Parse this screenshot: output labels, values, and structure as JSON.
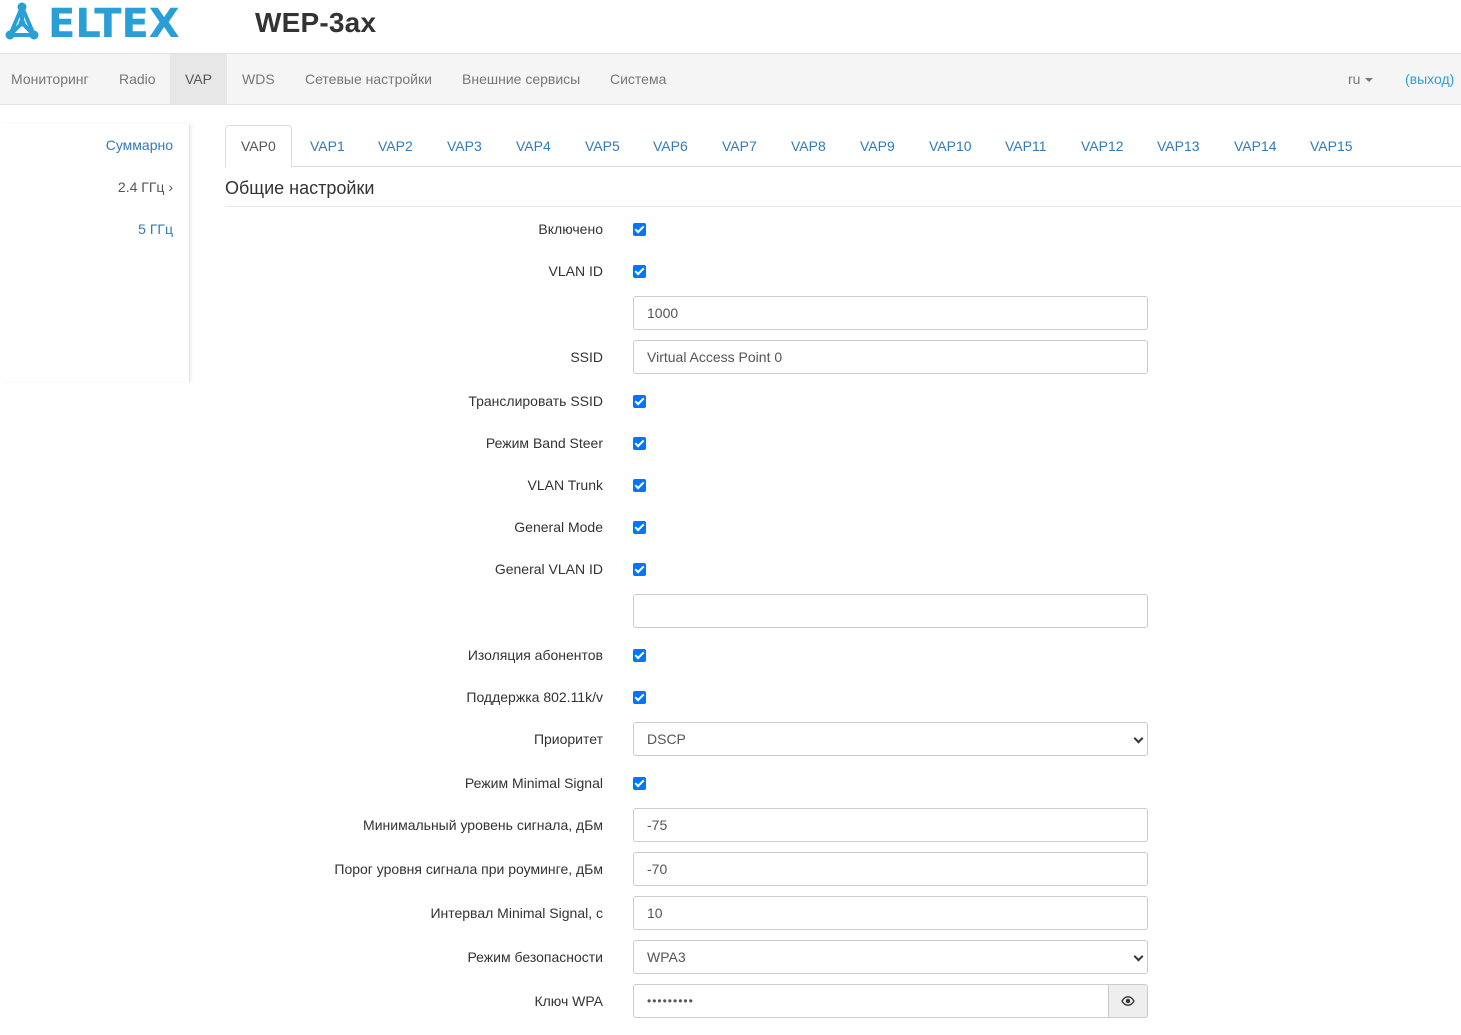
{
  "header": {
    "brand": "ELTEX",
    "model": "WEP-3ax"
  },
  "nav": {
    "items": [
      "Мониторинг",
      "Radio",
      "VAP",
      "WDS",
      "Сетевые настройки",
      "Внешние сервисы",
      "Система"
    ],
    "active": "VAP",
    "lang": "ru",
    "logout": "(выход)"
  },
  "sidebar": {
    "items": [
      "Суммарно",
      "2.4 ГГц ›",
      "5 ГГц"
    ]
  },
  "tabs": [
    "VAP0",
    "VAP1",
    "VAP2",
    "VAP3",
    "VAP4",
    "VAP5",
    "VAP6",
    "VAP7",
    "VAP8",
    "VAP9",
    "VAP10",
    "VAP11",
    "VAP12",
    "VAP13",
    "VAP14",
    "VAP15"
  ],
  "active_tab": "VAP0",
  "section_title": "Общие настройки",
  "form": {
    "enabled": {
      "label": "Включено",
      "checked": true
    },
    "vlan_id": {
      "label": "VLAN ID",
      "checked": true,
      "value": "1000"
    },
    "ssid": {
      "label": "SSID",
      "value": "Virtual Access Point 0"
    },
    "broadcast_ssid": {
      "label": "Транслировать SSID",
      "checked": true
    },
    "band_steer": {
      "label": "Режим Band Steer",
      "checked": true
    },
    "vlan_trunk": {
      "label": "VLAN Trunk",
      "checked": true
    },
    "general_mode": {
      "label": "General Mode",
      "checked": true
    },
    "general_vlan_id": {
      "label": "General VLAN ID",
      "checked": true,
      "value": ""
    },
    "station_isolation": {
      "label": "Изоляция абонентов",
      "checked": true
    },
    "support_80211kv": {
      "label": "Поддержка 802.11k/v",
      "checked": true
    },
    "priority": {
      "label": "Приоритет",
      "value": "DSCP"
    },
    "minimal_signal_mode": {
      "label": "Режим Minimal Signal",
      "checked": true
    },
    "min_signal_level": {
      "label": "Минимальный уровень сигнала, дБм",
      "value": "-75"
    },
    "roaming_threshold": {
      "label": "Порог уровня сигнала при роуминге, дБм",
      "value": "-70"
    },
    "minimal_signal_interval": {
      "label": "Интервал Minimal Signal, с",
      "value": "10"
    },
    "security_mode": {
      "label": "Режим безопасности",
      "value": "WPA3"
    },
    "wpa_key": {
      "label": "Ключ WPA",
      "value": "•••••••••"
    }
  },
  "colors": {
    "brand": "#2a9fd6",
    "link": "#337ab7",
    "checkbox": "#0075ff"
  }
}
